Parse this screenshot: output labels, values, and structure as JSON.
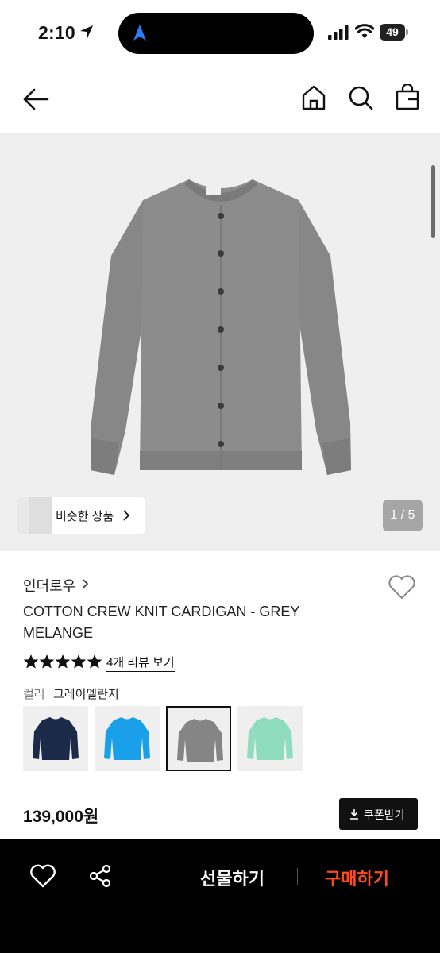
{
  "status_bar": {
    "time": "2:10",
    "battery": "49"
  },
  "product": {
    "image_counter": "1 / 5",
    "similar_label": "비슷한 상품",
    "brand": "인더로우",
    "title": "COTTON CREW KNIT CARDIGAN - GREY MELANGE",
    "rating_stars": 5,
    "reviews_link": "4개 리뷰 보기",
    "color_label": "컬러",
    "color_value": "그레이멜란지",
    "swatches": [
      {
        "name": "navy",
        "color": "#1c2a4a",
        "selected": false
      },
      {
        "name": "blue",
        "color": "#1aa0e8",
        "selected": false
      },
      {
        "name": "grey",
        "color": "#858585",
        "selected": true
      },
      {
        "name": "mint",
        "color": "#8fdcc0",
        "selected": false
      }
    ],
    "price": "139,000원",
    "coupon_label": "쿠폰받기"
  },
  "bottom_bar": {
    "gift_label": "선물하기",
    "buy_label": "구매하기",
    "buy_color": "#ff4a1e"
  },
  "colors": {
    "garment_grey": "#8a8a8a",
    "image_bg": "#efefef"
  }
}
